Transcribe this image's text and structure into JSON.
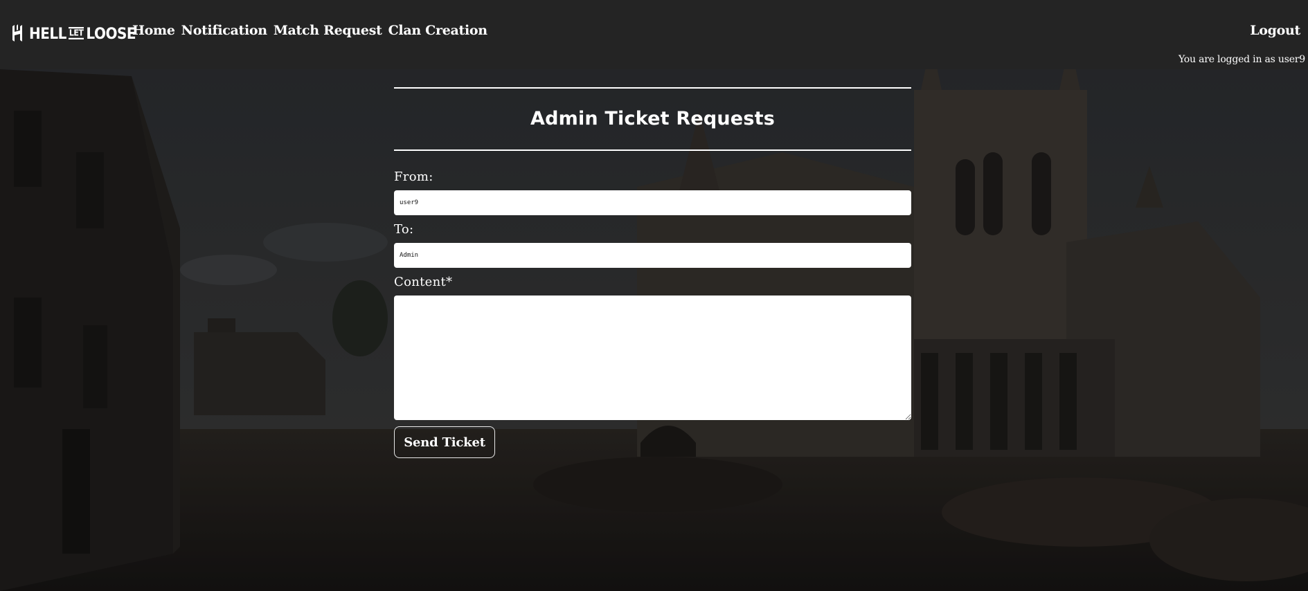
{
  "header": {
    "logo": {
      "icon": "hell-let-loose-logo-icon",
      "word1": "HELL",
      "word2": "LET",
      "word3": "LOOSE"
    },
    "nav": [
      {
        "label": "Home"
      },
      {
        "label": "Notification"
      },
      {
        "label": "Match Request"
      },
      {
        "label": "Clan Creation"
      }
    ],
    "logout_label": "Logout",
    "logged_in_text": "You are logged in as user9"
  },
  "form": {
    "title": "Admin Ticket Requests",
    "from_label": "From:",
    "from_value": "user9",
    "to_label": "To:",
    "to_value": "Admin",
    "content_label": "Content*",
    "content_value": "",
    "submit_label": "Send Ticket"
  },
  "colors": {
    "header_bg": "#242424",
    "text": "#ffffff",
    "input_bg": "#ffffff"
  }
}
